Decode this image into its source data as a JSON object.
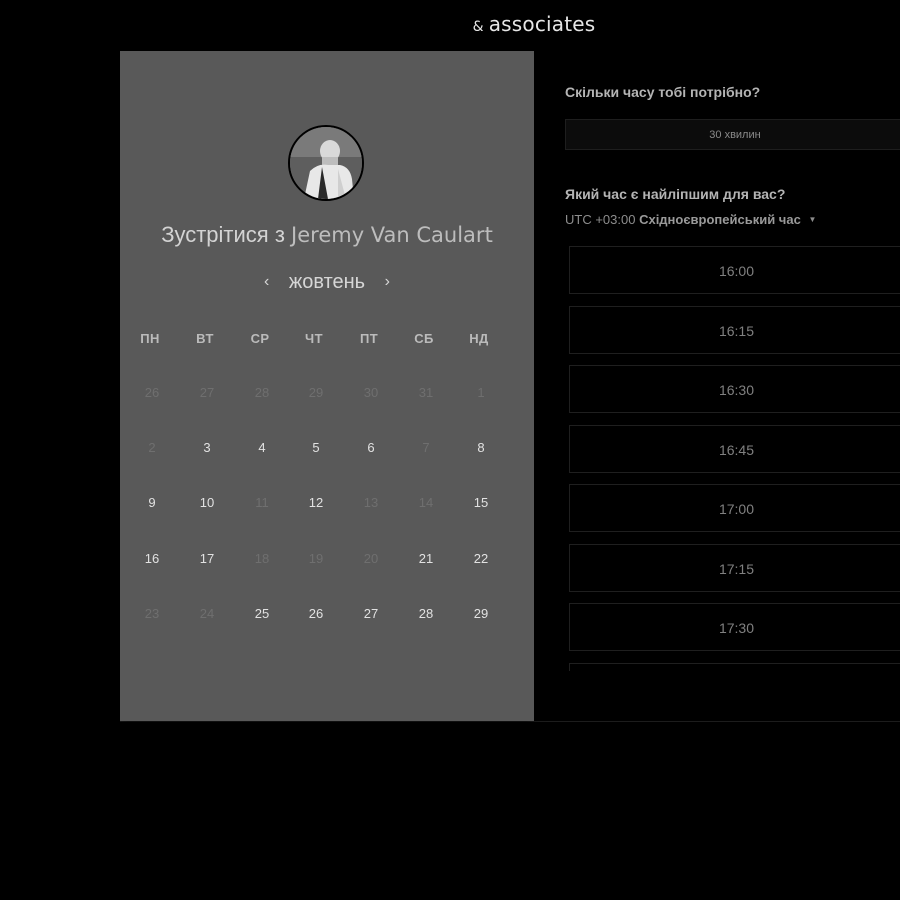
{
  "brand": {
    "amp": "&",
    "name": "associates"
  },
  "scheduler": {
    "title_prefix": "Зустрітися з",
    "host_name": "Jeremy Van Caulart",
    "month": "жовтень",
    "prev_icon": "chevron-left-icon",
    "next_icon": "chevron-right-icon",
    "weekdays": [
      "ПН",
      "ВТ",
      "СР",
      "ЧТ",
      "ПТ",
      "СБ",
      "НД"
    ],
    "weeks": [
      [
        {
          "d": "26",
          "available": false
        },
        {
          "d": "27",
          "available": false
        },
        {
          "d": "28",
          "available": false
        },
        {
          "d": "29",
          "available": false
        },
        {
          "d": "30",
          "available": false
        },
        {
          "d": "31",
          "available": false
        },
        {
          "d": "1",
          "available": false
        }
      ],
      [
        {
          "d": "2",
          "available": false
        },
        {
          "d": "3",
          "available": true
        },
        {
          "d": "4",
          "available": true
        },
        {
          "d": "5",
          "available": true
        },
        {
          "d": "6",
          "available": true
        },
        {
          "d": "7",
          "available": false
        },
        {
          "d": "8",
          "available": true
        }
      ],
      [
        {
          "d": "9",
          "available": true
        },
        {
          "d": "10",
          "available": true
        },
        {
          "d": "11",
          "available": false
        },
        {
          "d": "12",
          "available": true
        },
        {
          "d": "13",
          "available": false
        },
        {
          "d": "14",
          "available": false
        },
        {
          "d": "15",
          "available": true
        }
      ],
      [
        {
          "d": "16",
          "available": true
        },
        {
          "d": "17",
          "available": true
        },
        {
          "d": "18",
          "available": false
        },
        {
          "d": "19",
          "available": false
        },
        {
          "d": "20",
          "available": false
        },
        {
          "d": "21",
          "available": true
        },
        {
          "d": "22",
          "available": true
        }
      ],
      [
        {
          "d": "23",
          "available": false
        },
        {
          "d": "24",
          "available": false
        },
        {
          "d": "25",
          "available": true
        },
        {
          "d": "26",
          "available": true
        },
        {
          "d": "27",
          "available": true
        },
        {
          "d": "28",
          "available": true
        },
        {
          "d": "29",
          "available": true
        }
      ]
    ]
  },
  "booking": {
    "duration_question": "Скільки часу тобі потрібно?",
    "duration_value": "30 хвилин",
    "time_question": "Який час є найліпшим для вас?",
    "timezone_offset": "UTC +03:00",
    "timezone_name": "Східноєвропейський час",
    "timezone_caret_icon": "caret-down-icon",
    "slots": [
      "16:00",
      "16:15",
      "16:30",
      "16:45",
      "17:00",
      "17:15",
      "17:30",
      ""
    ]
  },
  "colors": {
    "page_bg": "#000000",
    "calendar_bg": "#595959",
    "available_day": "#e2e2e2",
    "unavailable_day": "#6f6f6f"
  }
}
